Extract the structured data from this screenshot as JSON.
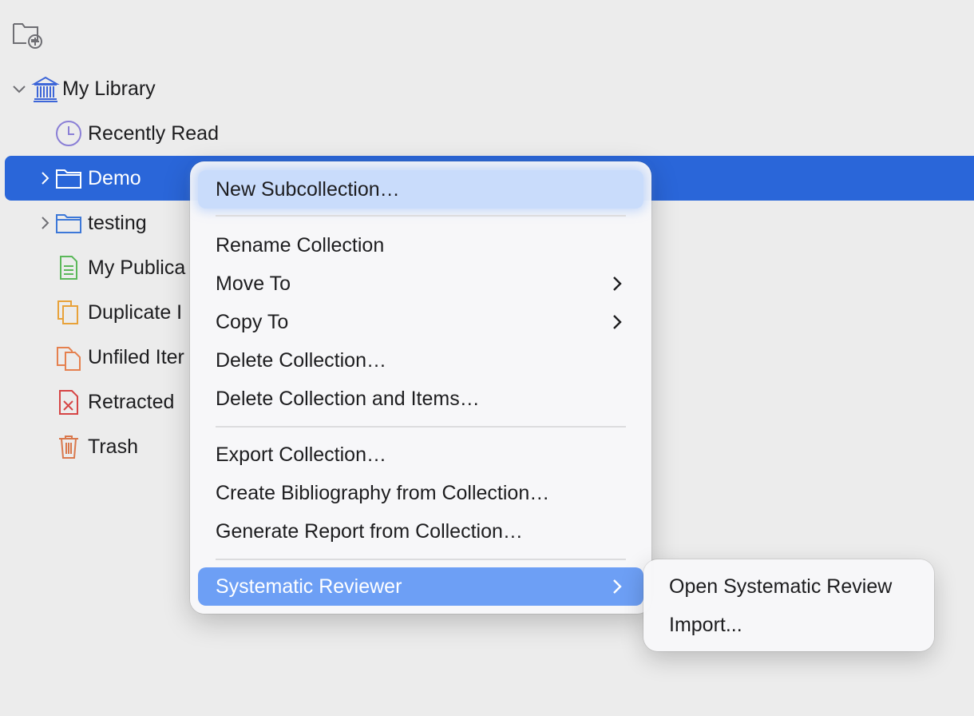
{
  "toolbar": {
    "new_collection_icon": "folder-plus-icon"
  },
  "tree": {
    "items": [
      {
        "label": "My Library",
        "icon": "library-icon",
        "expanded": true
      },
      {
        "label": "Recently Read",
        "icon": "clock-icon"
      },
      {
        "label": "Demo",
        "icon": "folder-icon",
        "selected": true,
        "has_children": true
      },
      {
        "label": "testing",
        "icon": "folder-icon",
        "has_children": true
      },
      {
        "label": "My Publica",
        "icon": "publications-icon"
      },
      {
        "label": "Duplicate I",
        "icon": "duplicate-icon"
      },
      {
        "label": "Unfiled Iter",
        "icon": "unfiled-icon"
      },
      {
        "label": "Retracted",
        "icon": "retracted-icon"
      },
      {
        "label": "Trash",
        "icon": "trash-icon"
      }
    ]
  },
  "context_menu": {
    "items": [
      {
        "label": "New Subcollection…"
      },
      {
        "label": "Rename Collection"
      },
      {
        "label": "Move To",
        "submenu": true
      },
      {
        "label": "Copy To",
        "submenu": true
      },
      {
        "label": "Delete Collection…"
      },
      {
        "label": "Delete Collection and Items…"
      },
      {
        "label": "Export Collection…"
      },
      {
        "label": "Create Bibliography from Collection…"
      },
      {
        "label": "Generate Report from Collection…"
      },
      {
        "label": "Systematic Reviewer",
        "submenu": true,
        "active": true
      }
    ]
  },
  "submenu": {
    "items": [
      {
        "label": "Open Systematic Review"
      },
      {
        "label": "Import..."
      }
    ]
  },
  "colors": {
    "selection": "#2a66d9",
    "menu_active": "#6d9ff5",
    "folder_blue": "#3d78d8"
  }
}
